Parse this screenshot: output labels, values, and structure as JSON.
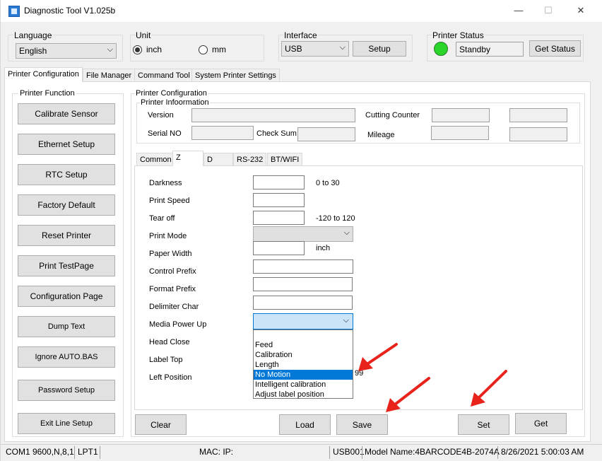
{
  "window": {
    "title": "Diagnostic Tool V1.025b",
    "minimize": "—",
    "maximize": "☐",
    "close": "✕"
  },
  "language": {
    "label": "Language",
    "value": "English"
  },
  "unit": {
    "label": "Unit",
    "options": [
      "inch",
      "mm"
    ],
    "selected": "inch"
  },
  "interface": {
    "label": "Interface",
    "value": "USB",
    "setup_label": "Setup"
  },
  "printer_status": {
    "label": "Printer  Status",
    "value": "Standby",
    "get_status_label": "Get Status",
    "led_color": "#29d629"
  },
  "main_tabs": [
    "Printer Configuration",
    "File Manager",
    "Command Tool",
    "System Printer Settings"
  ],
  "printer_function": {
    "label": "Printer  Function",
    "buttons": [
      "Calibrate Sensor",
      "Ethernet Setup",
      "RTC Setup",
      "Factory Default",
      "Reset Printer",
      "Print TestPage",
      "Configuration Page",
      "Dump Text",
      "Ignore AUTO.BAS",
      "Password Setup",
      "Exit Line Setup"
    ]
  },
  "printer_config": {
    "label": "Printer Configuration",
    "info_label": "Printer Infoormation",
    "version_label": "Version",
    "serial_label": "Serial NO",
    "checksum_label": "Check Sum",
    "cutting_label": "Cutting Counter",
    "mileage_label": "Mileage"
  },
  "sub_tabs": [
    "Common",
    "Z",
    "D",
    "RS-232",
    "BT/WIFI"
  ],
  "z_fields": {
    "darkness": "Darkness",
    "darkness_range": "0 to 30",
    "print_speed": "Print Speed",
    "tear_off": "Tear  off",
    "tear_off_range": "-120 to 120",
    "print_mode": "Print Mode",
    "paper_width": "Paper Width",
    "paper_width_unit": "inch",
    "control_prefix": "Control Prefix",
    "format_prefix": "Format Prefix",
    "delimiter_char": "Delimiter Char",
    "media_power_up": "Media Power Up",
    "head_close": "Head Close",
    "label_top": "Label Top",
    "left_position": "Left Position",
    "left_position_range_partial": "99"
  },
  "media_power_up_options": [
    "Feed",
    "Calibration",
    "Length",
    "No Motion",
    "Intelligent calibration",
    "Adjust label position"
  ],
  "media_power_up_highlighted": "No Motion",
  "bottom_buttons": {
    "clear": "Clear",
    "load": "Load",
    "save": "Save",
    "set": "Set",
    "get": "Get"
  },
  "status_bar": {
    "com": "COM1 9600,N,8,1",
    "lpt": "LPT1",
    "mac": "MAC: IP:",
    "usb": "USB001",
    "model": "Model Name:4BARCODE4B-2074A",
    "datetime": "8/26/2021 5:00:03 AM"
  },
  "annotation_color": "#e8231b"
}
